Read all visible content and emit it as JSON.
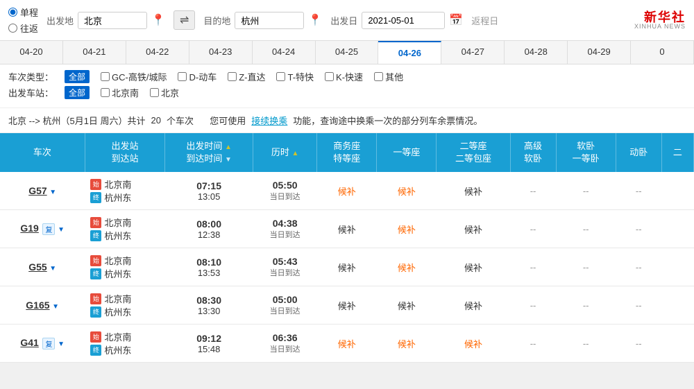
{
  "search": {
    "trip_types": [
      {
        "label": "单程",
        "selected": true
      },
      {
        "label": "往返",
        "selected": false
      }
    ],
    "from_label": "出发地",
    "from_value": "北京",
    "to_label": "目的地",
    "to_value": "杭州",
    "date_label": "出发日",
    "date_value": "2021-05-01",
    "return_label": "返程日",
    "swap_icon": "⇌"
  },
  "xinhua": {
    "cn": "新华社",
    "en": "XINHUA NEWS"
  },
  "date_tabs": [
    {
      "label": "04-20"
    },
    {
      "label": "04-21"
    },
    {
      "label": "04-22"
    },
    {
      "label": "04-23"
    },
    {
      "label": "04-24"
    },
    {
      "label": "04-25"
    },
    {
      "label": "04-26",
      "active": true
    },
    {
      "label": "04-27"
    },
    {
      "label": "04-28"
    },
    {
      "label": "04-29"
    },
    {
      "label": "0"
    }
  ],
  "filters": {
    "type_label": "车次类型：",
    "all_label": "全部",
    "type_options": [
      {
        "label": "GC-高铁/城际"
      },
      {
        "label": "D-动车"
      },
      {
        "label": "Z-直达"
      },
      {
        "label": "T-特快"
      },
      {
        "label": "K-快速"
      },
      {
        "label": "其他"
      }
    ],
    "station_label": "出发车站：",
    "station_all": "全部",
    "station_options": [
      {
        "label": "北京南"
      },
      {
        "label": "北京"
      }
    ]
  },
  "route_info": {
    "text": "北京 --> 杭州（5月1日 周六）共计",
    "count": "20",
    "count_suffix": "个车次",
    "tip_prefix": "您可使用",
    "link_text": "接续换乘",
    "tip_suffix": "功能，查询途中换乘一次的部分列车余票情况。"
  },
  "table": {
    "headers": [
      {
        "label": "车次",
        "sort": false
      },
      {
        "label": "出发站\n到达站",
        "sort": false
      },
      {
        "label": "出发时间 ▲\n到达时间 ▼",
        "sort": true
      },
      {
        "label": "历时 ▲",
        "sort": true
      },
      {
        "label": "商务座\n特等座",
        "sort": false
      },
      {
        "label": "一等座",
        "sort": false
      },
      {
        "label": "二等座\n二等包座",
        "sort": false
      },
      {
        "label": "高级\n软卧",
        "sort": false
      },
      {
        "label": "软卧\n一等卧",
        "sort": false
      },
      {
        "label": "动卧",
        "sort": false
      },
      {
        "label": "二",
        "sort": false
      }
    ],
    "rows": [
      {
        "no": "G57",
        "tag": "",
        "from_station": "北京南",
        "to_station": "杭州东",
        "depart": "07:15",
        "arrive": "13:05",
        "duration": "05:50",
        "same_day": "当日到达",
        "shangwu": "候补",
        "shangwu_orange": true,
        "yideng": "候补",
        "yideng_orange": true,
        "erdeng": "候补",
        "erdeng_orange": false,
        "gaoji": "--",
        "ruanwo": "--",
        "dongwo": "--"
      },
      {
        "no": "G19",
        "tag": "复",
        "from_station": "北京南",
        "to_station": "杭州东",
        "depart": "08:00",
        "arrive": "12:38",
        "duration": "04:38",
        "same_day": "当日到达",
        "shangwu": "候补",
        "shangwu_orange": false,
        "yideng": "候补",
        "yideng_orange": true,
        "erdeng": "候补",
        "erdeng_orange": false,
        "gaoji": "--",
        "ruanwo": "--",
        "dongwo": "--"
      },
      {
        "no": "G55",
        "tag": "",
        "from_station": "北京南",
        "to_station": "杭州东",
        "depart": "08:10",
        "arrive": "13:53",
        "duration": "05:43",
        "same_day": "当日到达",
        "shangwu": "候补",
        "shangwu_orange": false,
        "yideng": "候补",
        "yideng_orange": true,
        "erdeng": "候补",
        "erdeng_orange": false,
        "gaoji": "--",
        "ruanwo": "--",
        "dongwo": "--"
      },
      {
        "no": "G165",
        "tag": "",
        "from_station": "北京南",
        "to_station": "杭州东",
        "depart": "08:30",
        "arrive": "13:30",
        "duration": "05:00",
        "same_day": "当日到达",
        "shangwu": "候补",
        "shangwu_orange": false,
        "yideng": "候补",
        "yideng_orange": false,
        "erdeng": "候补",
        "erdeng_orange": false,
        "gaoji": "--",
        "ruanwo": "--",
        "dongwo": "--"
      },
      {
        "no": "G41",
        "tag": "复",
        "from_station": "北京南",
        "to_station": "杭州东",
        "depart": "09:12",
        "arrive": "15:48",
        "duration": "06:36",
        "same_day": "当日到达",
        "shangwu": "候补",
        "shangwu_orange": true,
        "yideng": "候补",
        "yideng_orange": true,
        "erdeng": "候补",
        "erdeng_orange": true,
        "gaoji": "--",
        "ruanwo": "--",
        "dongwo": "--"
      }
    ]
  }
}
